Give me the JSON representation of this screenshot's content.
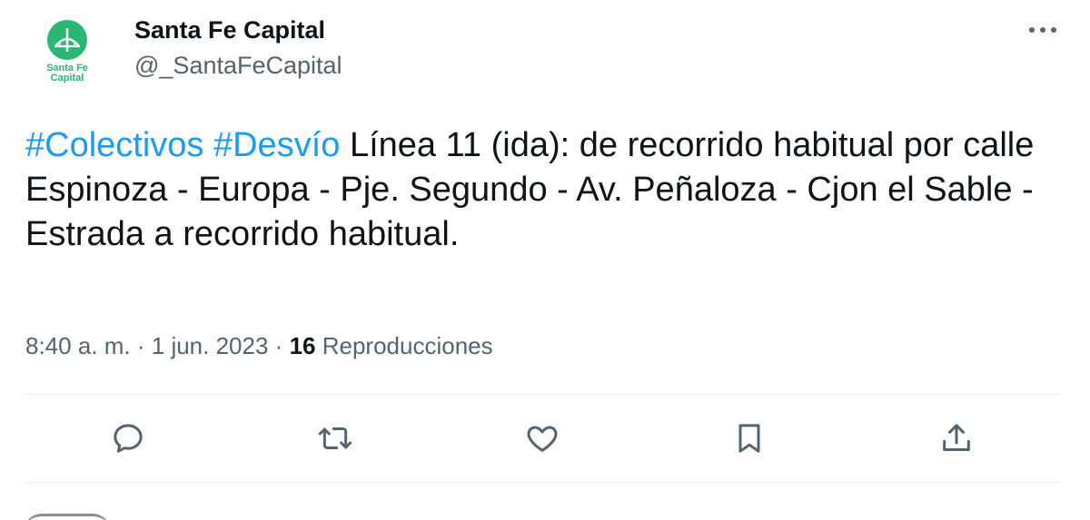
{
  "author": {
    "display_name": "Santa Fe Capital",
    "handle": "@_SantaFeCapital",
    "logo_text": "Santa Fe Capital"
  },
  "tweet": {
    "hashtags": [
      "#Colectivos",
      "#Desvío"
    ],
    "text": "Línea 11 (ida): de recorrido habitual por calle Espinoza - Europa  -  Pje. Segundo - Av. Peñaloza - Cjon el Sable - Estrada a recorrido habitual."
  },
  "meta": {
    "time": "8:40 a. m.",
    "separator": "·",
    "date": "1 jun. 2023",
    "views_count": "16",
    "views_label": "Reproducciones"
  },
  "actions": [
    {
      "name": "reply",
      "icon": "reply-icon"
    },
    {
      "name": "retweet",
      "icon": "retweet-icon"
    },
    {
      "name": "like",
      "icon": "heart-icon"
    },
    {
      "name": "bookmark",
      "icon": "bookmark-icon"
    },
    {
      "name": "share",
      "icon": "share-icon"
    }
  ],
  "colors": {
    "hashtag": "#1d9bf0",
    "secondary_text": "#536471",
    "brand_green": "#2bb673",
    "icon_gray": "#536471"
  }
}
